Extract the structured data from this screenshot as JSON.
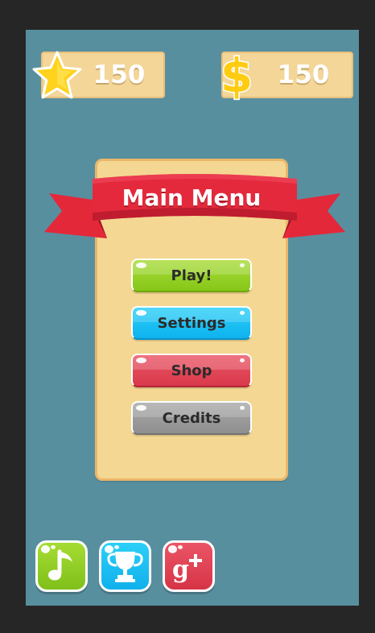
{
  "hud": {
    "stars": "150",
    "coins": "150",
    "star_icon": "star-icon",
    "coin_icon": "dollar-icon"
  },
  "menu": {
    "title": "Main Menu",
    "buttons": [
      {
        "label": "Play!",
        "color": "#93d121"
      },
      {
        "label": "Settings",
        "color": "#14b8f1"
      },
      {
        "label": "Shop",
        "color": "#e04556"
      },
      {
        "label": "Credits",
        "color": "#9a9a9a"
      }
    ]
  },
  "bottom_bar": {
    "music_icon": "music-note-icon",
    "leaderboard_icon": "trophy-icon",
    "social_icon": "google-plus-icon"
  },
  "colors": {
    "background": "#588f9f",
    "panel": "#f4d792",
    "ribbon": "#e3283a"
  }
}
